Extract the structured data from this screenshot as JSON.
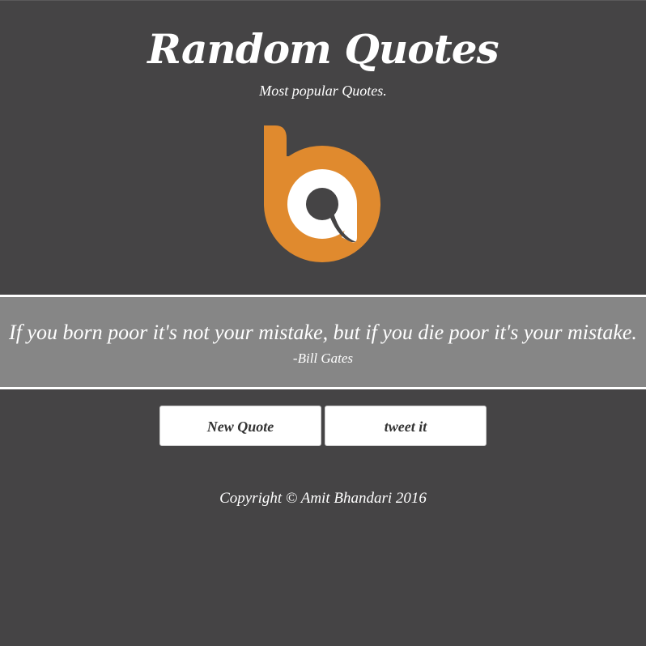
{
  "header": {
    "title": "Random Quotes",
    "subtitle": "Most popular Quotes."
  },
  "logo": {
    "icon": "ba-logo-icon",
    "color": "#e08a2e"
  },
  "quote": {
    "text": "If you born poor it's not your mistake, but if you die poor it's your mistake.",
    "author": "-Bill Gates"
  },
  "buttons": {
    "new_quote": "New Quote",
    "tweet": "tweet it"
  },
  "footer": {
    "copyright": "Copyright © Amit Bhandari 2016"
  },
  "colors": {
    "background": "#454445",
    "quote_band": "#868686",
    "accent": "#e08a2e",
    "text": "#ffffff"
  }
}
